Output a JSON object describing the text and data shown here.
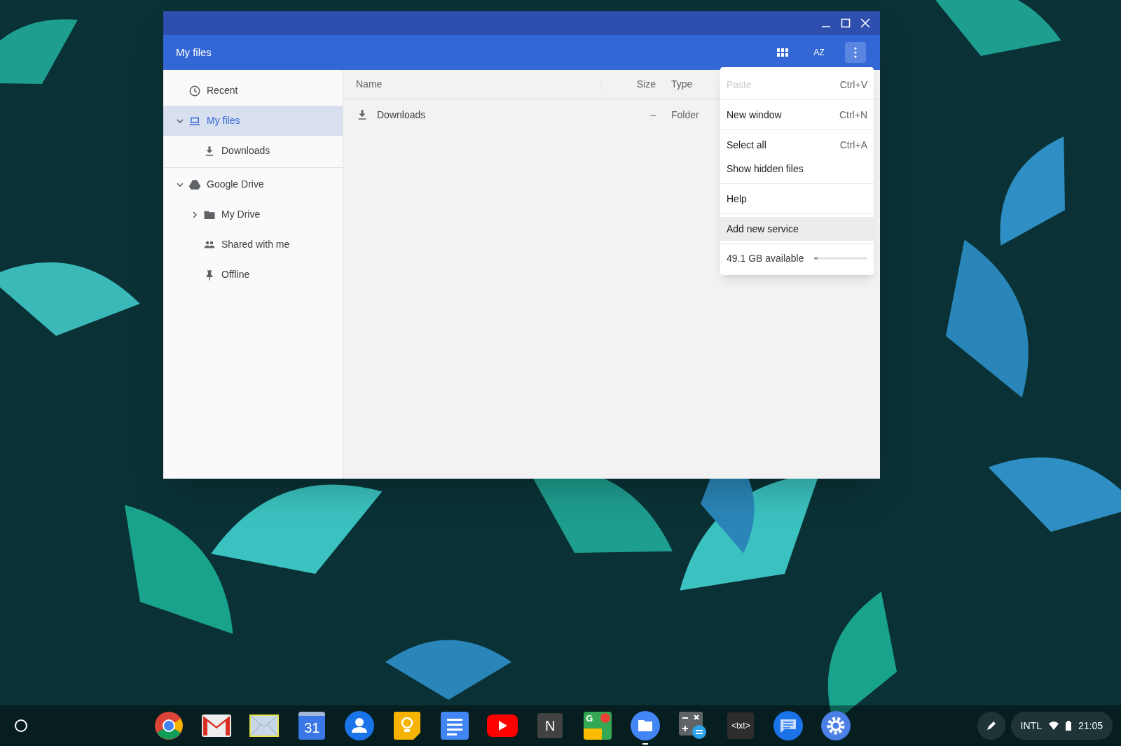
{
  "window": {
    "title": "My files",
    "toolbar": [
      {
        "kind": "grid"
      },
      {
        "kind": "sort",
        "label": "AZ"
      },
      {
        "kind": "more",
        "selected": true
      }
    ]
  },
  "sidebar": {
    "items": [
      {
        "label": "Recent",
        "kind": "recent",
        "selected": false
      },
      {
        "label": "My files",
        "kind": "local",
        "selected": true,
        "expanded": true,
        "children": [
          {
            "label": "Downloads",
            "kind": "downloads",
            "selected": false
          }
        ]
      },
      {
        "label": "Google Drive",
        "kind": "drive",
        "selected": false,
        "expanded": true,
        "children": [
          {
            "label": "My Drive",
            "kind": "my-drive",
            "selected": false,
            "expanded": false
          },
          {
            "label": "Shared with me",
            "kind": "shared",
            "selected": false
          },
          {
            "label": "Offline",
            "kind": "offline",
            "selected": false
          }
        ]
      }
    ]
  },
  "table": {
    "columns": [
      "Name",
      "Size",
      "Type"
    ],
    "rows": [
      {
        "name": "Downloads",
        "size": "–",
        "type": "Folder",
        "kind": "downloads"
      }
    ]
  },
  "menu": {
    "groups": [
      [
        {
          "label": "Paste",
          "shortcut": "Ctrl+V",
          "disabled": true,
          "selected": false
        }
      ],
      [
        {
          "label": "New window",
          "shortcut": "Ctrl+N",
          "disabled": false,
          "selected": false
        }
      ],
      [
        {
          "label": "Select all",
          "shortcut": "Ctrl+A",
          "disabled": false,
          "selected": false
        },
        {
          "label": "Show hidden files",
          "disabled": false,
          "selected": false
        }
      ],
      [
        {
          "label": "Help",
          "disabled": false,
          "selected": false
        }
      ],
      [
        {
          "label": "Add new service",
          "disabled": false,
          "selected": true
        }
      ]
    ],
    "storage": {
      "label": "49.1 GB available",
      "level": 0.03
    }
  },
  "shelf": {
    "apps": [
      {
        "kind": "chrome"
      },
      {
        "kind": "gmail"
      },
      {
        "kind": "mail"
      },
      {
        "kind": "calendar",
        "glyph": "31"
      },
      {
        "kind": "contacts"
      },
      {
        "kind": "keep"
      },
      {
        "kind": "docs"
      },
      {
        "kind": "youtube"
      },
      {
        "kind": "notes",
        "glyph": "N"
      },
      {
        "kind": "maps",
        "glyph": "G"
      },
      {
        "kind": "files",
        "selected": true
      },
      {
        "kind": "calculator"
      },
      {
        "kind": "text",
        "glyph": "<txt>"
      },
      {
        "kind": "messages"
      },
      {
        "kind": "settings"
      }
    ],
    "status": {
      "input": "INTL",
      "time": "21:05"
    }
  }
}
